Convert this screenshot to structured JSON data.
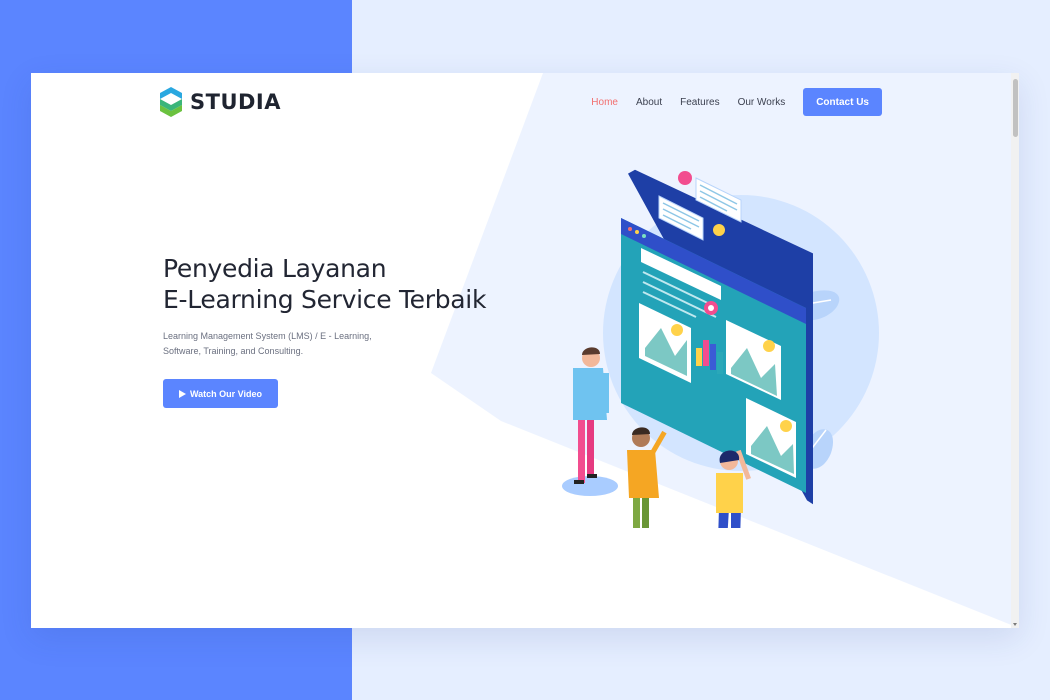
{
  "brand": {
    "name": "STUDIA",
    "logo_icon": "studia-s-logo-icon",
    "colors": {
      "logo_blue": "#2aa8e0",
      "logo_green": "#6bc23f"
    }
  },
  "nav": {
    "items": [
      {
        "label": "Home",
        "active": true
      },
      {
        "label": "About",
        "active": false
      },
      {
        "label": "Features",
        "active": false
      },
      {
        "label": "Our Works",
        "active": false
      }
    ],
    "cta_label": "Contact Us"
  },
  "hero": {
    "title_line1": "Penyedia Layanan",
    "title_line2": "E-Learning Service Terbaik",
    "subtitle": "Learning Management System (LMS) / E - Learning, Software, Training, and Consulting.",
    "button_label": "Watch Our Video",
    "button_icon": "play-icon",
    "illustration": "e-learning-team-illustration"
  },
  "theme": {
    "accent": "#5b85ff",
    "active_link": "#f26f6f",
    "page_background": "#e5eeff",
    "hero_shape": "#edf3ff"
  }
}
